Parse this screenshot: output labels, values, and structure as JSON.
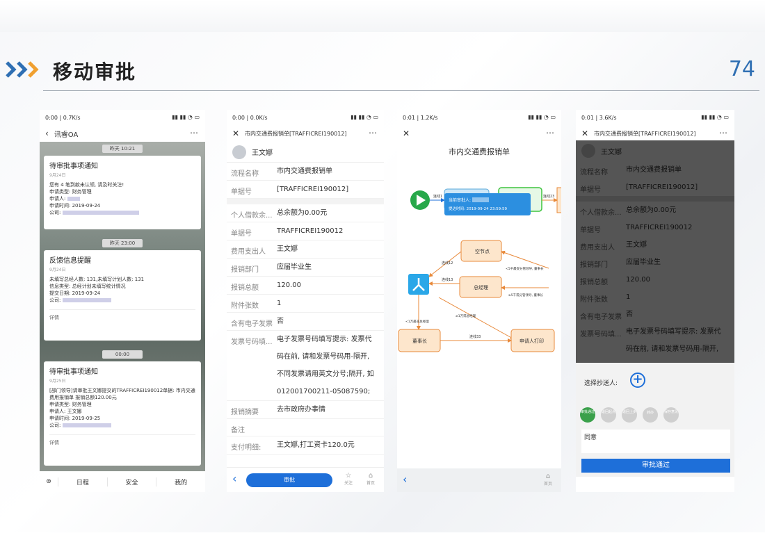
{
  "slide": {
    "title": "移动审批",
    "page_number": "74",
    "accent_colors": [
      "#2f6fb3",
      "#f0a030"
    ]
  },
  "phone1": {
    "status_left": "0:00 | 0.7K/s",
    "nav_title": "讯睿OA",
    "messages": [
      {
        "timestamp": "昨天 10:21",
        "title": "待审批事项通知",
        "date": "9月24日",
        "lines": [
          "您有 4 笔到款未认领, 请及时关注!",
          "申请类型: 财务管理",
          "申请人:",
          "申请时间: 2019-09-24",
          "公司:"
        ]
      },
      {
        "timestamp": "昨天 23:00",
        "title": "反馈信息提醒",
        "date": "9月24日",
        "lines": [
          "未填写总经人数: 131,未填写计划人数: 131",
          "信息类型: 总经计划未填写统计情况",
          "提交日期: 2019-09-24",
          "公司:"
        ],
        "detail": "详情"
      },
      {
        "timestamp": "00:00",
        "title": "待审批事项通知",
        "date": "9月25日",
        "lines": [
          "[部门领导]请审批王文娜提交的TRAFFICREI190012单据: 市内交通费用报销单 报销总额120.00元",
          "申请类型: 财务管理",
          "申请人: 王文娜",
          "申请时间: 2019-09-25",
          "公司:"
        ],
        "detail": "详情"
      }
    ],
    "tabs": [
      "日程",
      "安全",
      "我的"
    ]
  },
  "phone2": {
    "status_left": "0:00 | 0.0K/s",
    "nav_title": "市内交通费报销单[TRAFFICREI190012]",
    "applicant": "王文娜",
    "rows_a": [
      {
        "k": "流程名称",
        "v": "市内交通费报销单"
      },
      {
        "k": "单据号",
        "v": "[TRAFFICREI190012]"
      }
    ],
    "rows_b": [
      {
        "k": "个人借款余...",
        "v": "总余额为0.00元"
      },
      {
        "k": "单据号",
        "v": "TRAFFICREI190012"
      },
      {
        "k": "费用支出人",
        "v": "王文娜"
      },
      {
        "k": "报销部门",
        "v": "应届毕业生"
      },
      {
        "k": "报销总额",
        "v": "120.00"
      },
      {
        "k": "附件张数",
        "v": "1"
      },
      {
        "k": "含有电子发票",
        "v": "否"
      }
    ],
    "invoice_label": "发票号码填...",
    "invoice_lines": [
      "电子发票号码填写提示: 发票代",
      "码在前, 请和发票号码用-隔开,",
      "不同发票请用英文分号;隔开, 如",
      "012001700211-05087590;"
    ],
    "rows_c": [
      {
        "k": "报销摘要",
        "v": "去市政府办事情"
      },
      {
        "k": "备注",
        "v": ""
      },
      {
        "k": "支付明细:",
        "v": "王文娜,打工资卡120.0元"
      }
    ],
    "approve_label": "审批",
    "follow_label": "关注",
    "home_label": "首页"
  },
  "phone3": {
    "status_left": "0:01 | 1.2K/s",
    "flow_title": "市内交通费报销单",
    "tooltip_line1": "当前审批人:",
    "tooltip_line2": "提达时间: 2019-09-24 23:59:59",
    "nodes": [
      "空节点",
      "总经理",
      "董事长",
      "申请人打印"
    ],
    "edges": [
      "连线1",
      "连线12",
      "连线13",
      "<5千最受分管领导, 董事长",
      "≥5千或分管领导, 董事长",
      "<1万最非总经理",
      "≥1万或总经理",
      "连线33",
      "连线23"
    ],
    "home_label": "首页"
  },
  "phone4": {
    "status_left": "0:01 | 3.6K/s",
    "nav_title": "市内交通费报销单[TRAFFICREI190012]",
    "applicant": "王文娜",
    "rows_a": [
      {
        "k": "流程名称",
        "v": "市内交通费报销单"
      },
      {
        "k": "单据号",
        "v": "[TRAFFICREI190012]"
      }
    ],
    "rows_b": [
      {
        "k": "个人借款余...",
        "v": "总余额为0.00元"
      },
      {
        "k": "单据号",
        "v": "TRAFFICREI190012"
      },
      {
        "k": "费用支出人",
        "v": "王文娜"
      },
      {
        "k": "报销部门",
        "v": "应届毕业生"
      },
      {
        "k": "报销总额",
        "v": "120.00"
      },
      {
        "k": "附件张数",
        "v": "1"
      },
      {
        "k": "含有电子发票",
        "v": "否"
      }
    ],
    "invoice_label": "发票号码填...",
    "invoice_lines": [
      "电子发票号码填写提示: 发票代",
      "码在前, 请和发票号码用-隔开,"
    ],
    "cc_label": "选择抄送人:",
    "actions": [
      "审批通过",
      "退回起点",
      "退回上步",
      "转办",
      "保存意见"
    ],
    "comment": "同意",
    "submit": "审批通过"
  }
}
